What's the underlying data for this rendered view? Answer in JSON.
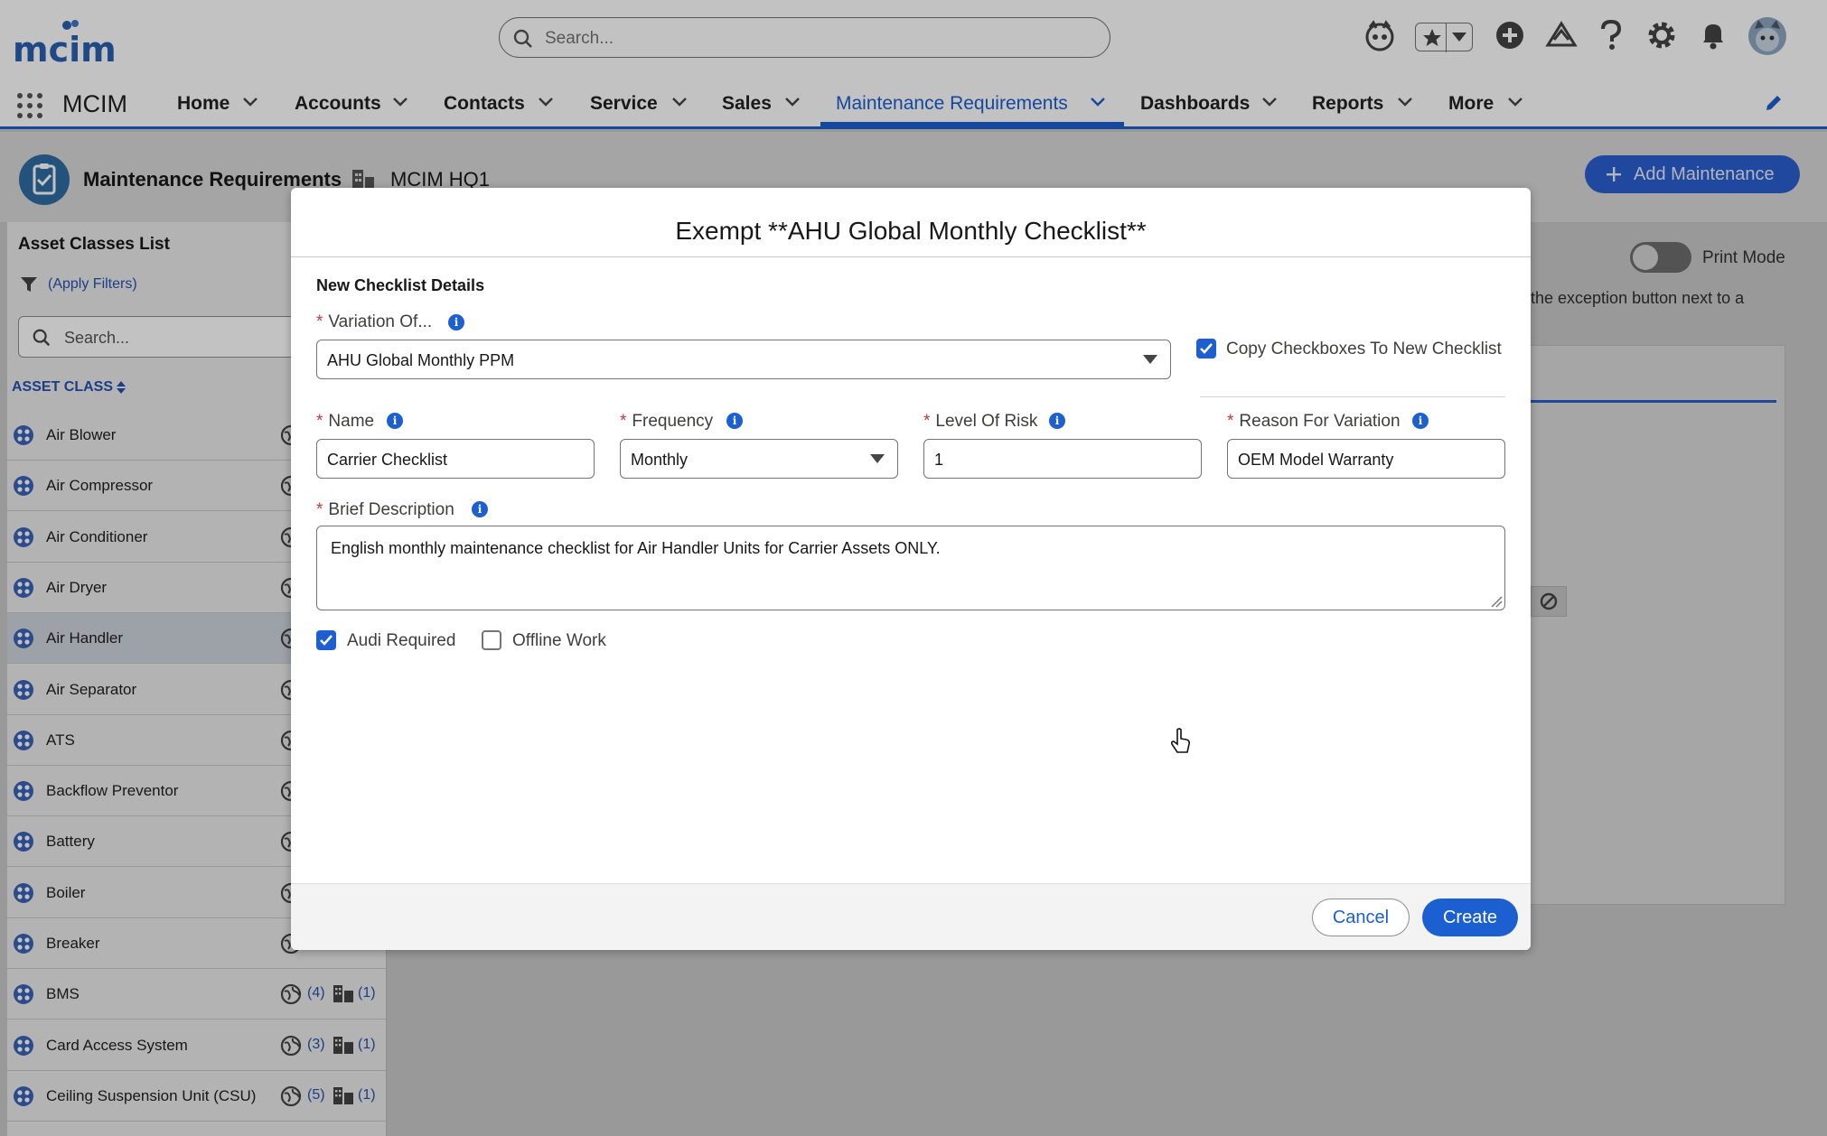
{
  "header": {
    "logo_text": "mcim",
    "search_placeholder": "Search...",
    "icons": [
      "einstein-icon",
      "favorites-star-icon",
      "add-icon",
      "trailhead-icon",
      "help-icon",
      "setup-gear-icon",
      "notifications-bell-icon",
      "avatar"
    ]
  },
  "nav": {
    "app_name": "MCIM",
    "items": [
      {
        "label": "Home"
      },
      {
        "label": "Accounts"
      },
      {
        "label": "Contacts"
      },
      {
        "label": "Service"
      },
      {
        "label": "Sales"
      },
      {
        "label": "Maintenance Requirements"
      },
      {
        "label": "Dashboards"
      },
      {
        "label": "Reports"
      },
      {
        "label": "More"
      }
    ],
    "active": "Maintenance Requirements"
  },
  "page": {
    "title": "Maintenance Requirements",
    "site": "MCIM HQ1",
    "add_button": "Add Maintenance",
    "print_mode": "Print Mode",
    "hint": "the exception button next to a"
  },
  "sidebar": {
    "title": "Asset Classes List",
    "filter": "(Apply Filters)",
    "search_placeholder": "Search...",
    "column": "ASSET CLASS",
    "items": [
      {
        "name": "Air Blower"
      },
      {
        "name": "Air Compressor"
      },
      {
        "name": "Air Conditioner"
      },
      {
        "name": "Air Dryer"
      },
      {
        "name": "Air Handler"
      },
      {
        "name": "Air Separator"
      },
      {
        "name": "ATS"
      },
      {
        "name": "Backflow Preventor"
      },
      {
        "name": "Battery"
      },
      {
        "name": "Boiler"
      },
      {
        "name": "Breaker"
      },
      {
        "name": "BMS",
        "global": "(4)",
        "site": "(1)"
      },
      {
        "name": "Card Access System",
        "global": "(3)",
        "site": "(1)"
      },
      {
        "name": "Ceiling Suspension Unit (CSU)",
        "global": "(5)",
        "site": "(1)"
      }
    ],
    "selected": "Air Handler"
  },
  "modal": {
    "title": "Exempt **AHU Global Monthly Checklist**",
    "section": "New Checklist Details",
    "variation_label": "Variation Of...",
    "variation_value": "AHU Global Monthly PPM",
    "copy_checkboxes_label": "Copy Checkboxes To New Checklist",
    "copy_checkboxes_checked": true,
    "name_label": "Name",
    "name_value": "Carrier Checklist",
    "frequency_label": "Frequency",
    "frequency_value": "Monthly",
    "risk_label": "Level Of Risk",
    "risk_value": "1",
    "reason_label": "Reason For Variation",
    "reason_value": "OEM Model Warranty",
    "description_label": "Brief Description",
    "description_value": "English monthly maintenance checklist for Air Handler Units for Carrier Assets ONLY.",
    "audit_label": "Audi Required",
    "audit_checked": true,
    "offline_label": "Offline Work",
    "offline_checked": false,
    "cancel": "Cancel",
    "create": "Create",
    "required_mark": "*",
    "info_glyph": "i"
  },
  "colors": {
    "brand_blue": "#1b5fd0",
    "required_red": "#c23934"
  }
}
